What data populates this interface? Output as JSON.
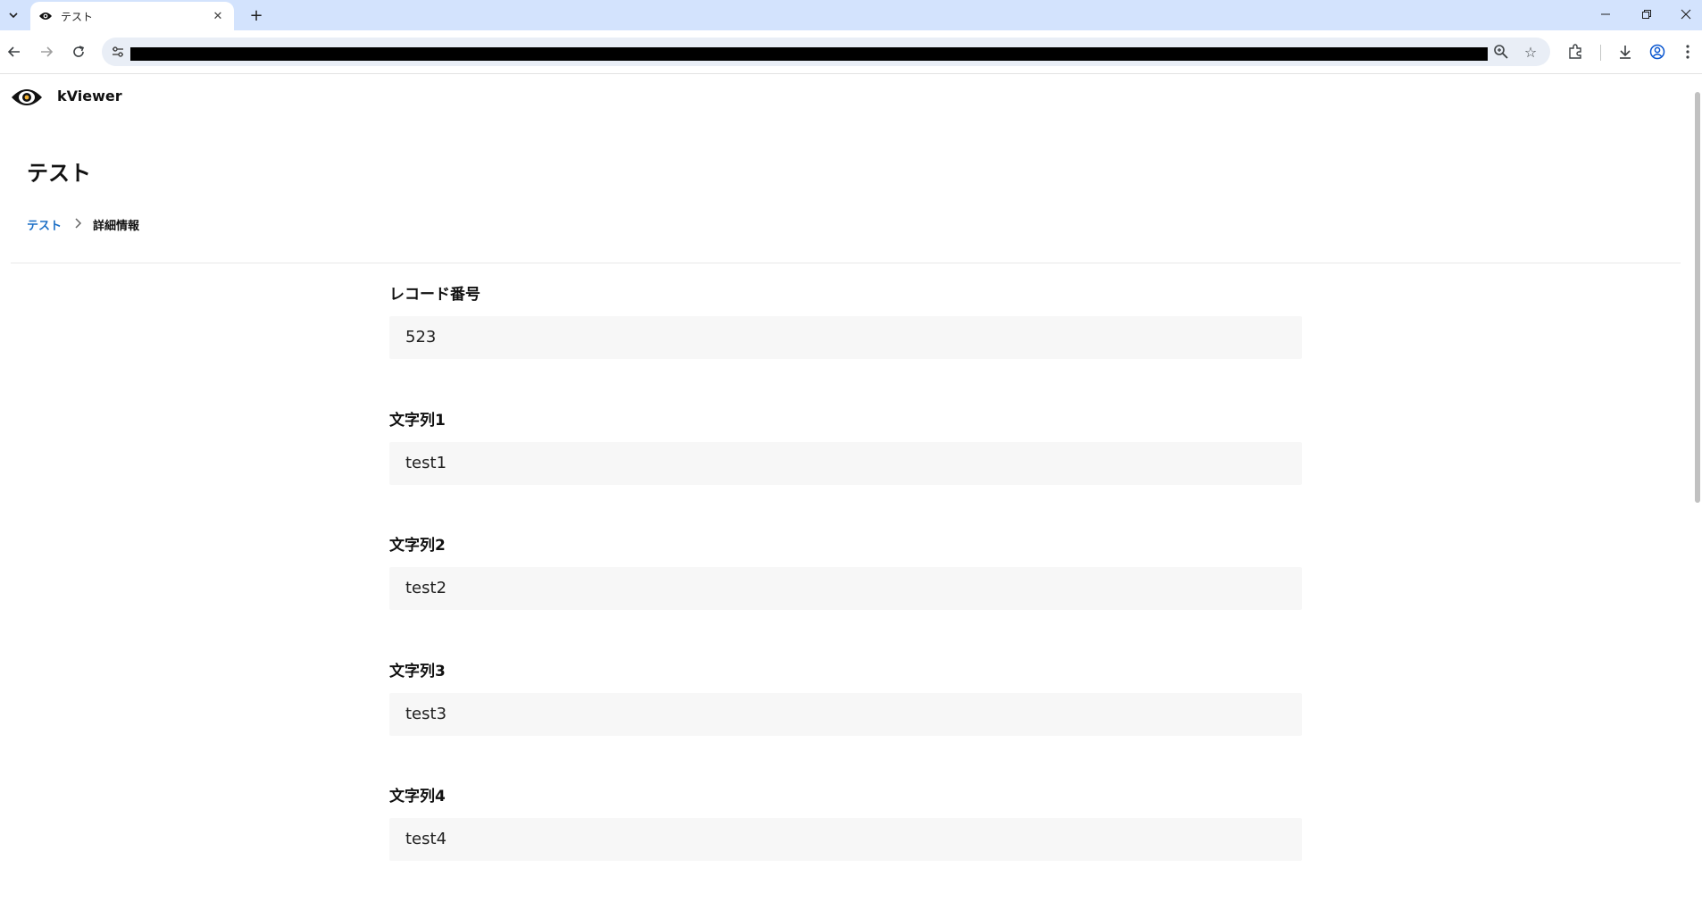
{
  "browser": {
    "tab_title": "テスト",
    "url": ""
  },
  "app": {
    "brand": "kViewer",
    "page_title": "テスト",
    "breadcrumb": {
      "link": "テスト",
      "current": "詳細情報"
    }
  },
  "fields": [
    {
      "label": "レコード番号",
      "value": "523"
    },
    {
      "label": "文字列1",
      "value": "test1"
    },
    {
      "label": "文字列2",
      "value": "test2"
    },
    {
      "label": "文字列3",
      "value": "test3"
    },
    {
      "label": "文字列4",
      "value": "test4"
    }
  ],
  "colors": {
    "accent_link": "#1c6fc6",
    "tabstrip": "#d3e3fd",
    "field_bg": "#f7f7f7"
  }
}
